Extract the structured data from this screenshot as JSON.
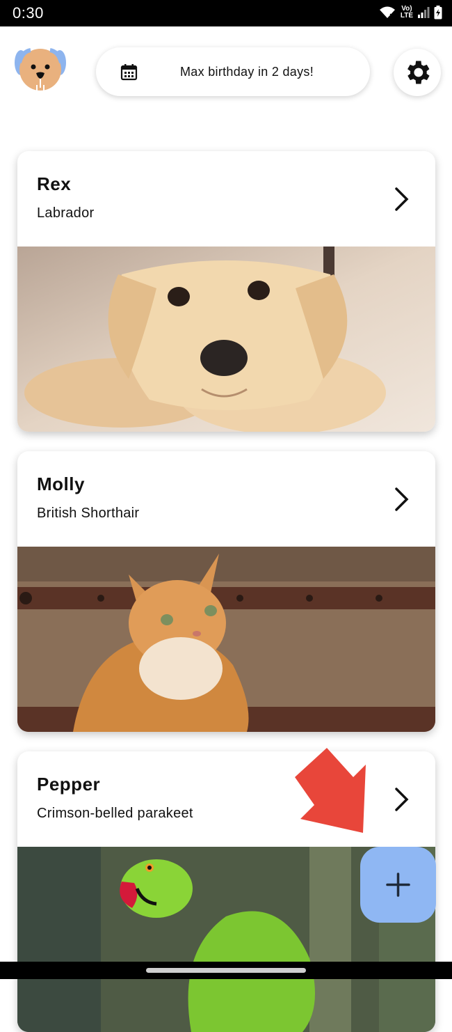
{
  "status_bar": {
    "time": "0:30",
    "network_label_top": "Vo)",
    "network_label_bottom": "LTE"
  },
  "header": {
    "avatar": {
      "icon": "dog-face-icon"
    },
    "reminder": {
      "icon": "calendar-icon",
      "text": "Max birthday in 2 days!"
    },
    "settings": {
      "icon": "gear-icon"
    }
  },
  "pets": [
    {
      "name": "Rex",
      "breed": "Labrador",
      "photo": "labrador-puppy-photo"
    },
    {
      "name": "Molly",
      "breed": "British Shorthair",
      "photo": "orange-cat-photo"
    },
    {
      "name": "Pepper",
      "breed": "Crimson-belled parakeet",
      "photo": "green-parakeet-photo"
    }
  ],
  "fab": {
    "icon": "plus-icon"
  },
  "annotation": {
    "icon": "red-arrow-annotation",
    "color": "#e8463a"
  },
  "colors": {
    "fab": "#8fb7f3",
    "background": "#ffffff",
    "status_bar": "#000000"
  }
}
